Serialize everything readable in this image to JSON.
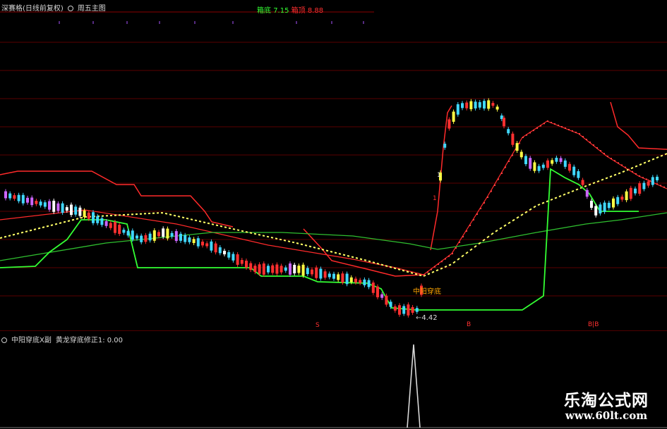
{
  "main_header": {
    "mode": "深赛格(日线前复权)",
    "formula": "周五主图"
  },
  "hint": {
    "box_label": "箱底",
    "box_value": "7.15",
    "top_label": "箱顶",
    "top_value": "8.88"
  },
  "annotations": {
    "signal_text": "中阳穿底",
    "low_price": "4.42",
    "marker_1": "1",
    "marker_1b": "1",
    "bottom_a": "S",
    "bottom_b": "B",
    "bottom_c": "B|B"
  },
  "indicator_header": {
    "name": "中阳穿底X副",
    "formula": "黄龙穿底修正1: 0.00"
  },
  "watermark": {
    "title": "乐淘公式网",
    "url": "www.60lt.com"
  },
  "colors": {
    "background": "#000000",
    "grid": "#5a0000",
    "up": "#ff3030",
    "down": "#40d8ff",
    "green_line": "#33ff33",
    "yellow_line": "#ffff66",
    "red_line": "#ff2a2a",
    "indicator_line": "#d9d9d9"
  }
}
